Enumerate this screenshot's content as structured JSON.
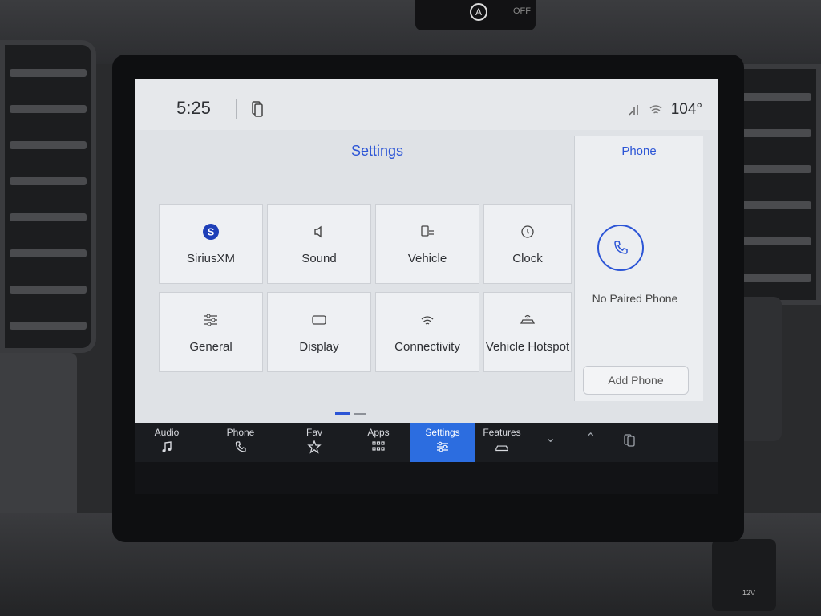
{
  "status_bar": {
    "time": "5:25",
    "temperature": "104°",
    "icons": [
      "phone-projection-icon",
      "signal-icon",
      "wifi-icon"
    ]
  },
  "settings": {
    "title": "Settings",
    "tiles": [
      {
        "label": "SiriusXM",
        "icon": "siriusxm-icon"
      },
      {
        "label": "Sound",
        "icon": "speaker-icon"
      },
      {
        "label": "Vehicle",
        "icon": "vehicle-settings-icon"
      },
      {
        "label": "Clock",
        "icon": "clock-icon"
      },
      {
        "label": "General",
        "icon": "sliders-icon"
      },
      {
        "label": "Display",
        "icon": "display-icon"
      },
      {
        "label": "Connectivity",
        "icon": "wifi-icon"
      },
      {
        "label": "Vehicle Hotspot",
        "icon": "hotspot-icon"
      }
    ]
  },
  "phone_panel": {
    "title": "Phone",
    "status": "No Paired Phone",
    "add_button": "Add Phone"
  },
  "nav": {
    "items": [
      {
        "label": "Audio",
        "icon": "music-note-icon"
      },
      {
        "label": "Phone",
        "icon": "phone-icon"
      },
      {
        "label": "Fav",
        "icon": "star-icon"
      },
      {
        "label": "Apps",
        "icon": "grid-icon"
      },
      {
        "label": "Settings",
        "icon": "sliders-icon"
      },
      {
        "label": "Features",
        "icon": "car-icon"
      }
    ],
    "active": "Settings"
  },
  "hazard_switch": {
    "label": "OFF"
  },
  "power_port": {
    "label": "12V"
  },
  "colors": {
    "accent": "#2c55d6",
    "active_tab": "#2c6de0",
    "nav_bg": "#1a1c20",
    "screen_bg": "#dfe2e6"
  }
}
